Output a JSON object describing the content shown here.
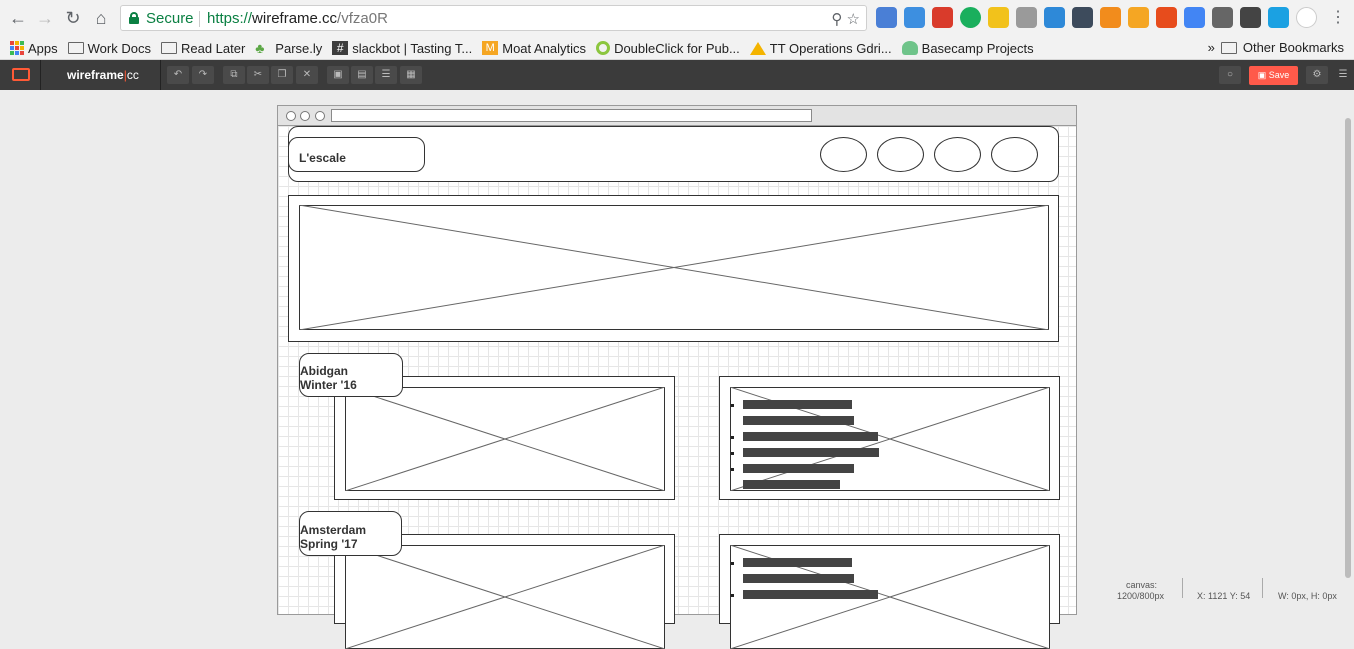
{
  "browser": {
    "secure_label": "Secure",
    "url_scheme": "https://",
    "url_host": "wireframe.cc",
    "url_path": "/vfza0R",
    "extension_icons": [
      "calendar-icon",
      "docs-icon",
      "bookmark-red-icon",
      "evernote-icon",
      "drive-icon",
      "chart-icon",
      "badge-icon",
      "dots-icon",
      "trend-icon",
      "moat-icon",
      "office-icon",
      "translate-icon",
      "inbox-icon",
      "tag-icon",
      "ct-icon",
      "circle-icon"
    ]
  },
  "bookmarks": {
    "items": [
      {
        "label": "Apps",
        "icon": "apps-grid-icon"
      },
      {
        "label": "Work Docs",
        "icon": "folder-icon"
      },
      {
        "label": "Read Later",
        "icon": "folder-icon"
      },
      {
        "label": "Parse.ly",
        "icon": "parsely-icon"
      },
      {
        "label": "slackbot | Tasting T...",
        "icon": "hash-icon"
      },
      {
        "label": "Moat Analytics",
        "icon": "moat-icon"
      },
      {
        "label": "DoubleClick for Pub...",
        "icon": "doubleclick-icon"
      },
      {
        "label": "TT Operations Gdri...",
        "icon": "drive-icon"
      },
      {
        "label": "Basecamp Projects",
        "icon": "basecamp-icon"
      }
    ],
    "overflow_label": "»",
    "other_label": "Other Bookmarks"
  },
  "app": {
    "brand_name": "wireframe",
    "brand_sep": "|",
    "brand_suffix": "cc",
    "save_label": "Save",
    "colors": {
      "accent": "#ff5a36",
      "toolbar_bg": "#3b3b3b",
      "save_bg": "#ff5a4a"
    }
  },
  "wireframe": {
    "header_title": "L'escale",
    "sections": [
      {
        "title_line1": "Abidgan",
        "title_line2": "Winter '16"
      },
      {
        "title_line1": "Amsterdam",
        "title_line2": "Spring '17"
      }
    ]
  },
  "status": {
    "canvas_label": "canvas:",
    "canvas_size": "1200/800px",
    "coords": "X: 1121 Y: 54",
    "dimensions": "W: 0px, H: 0px"
  }
}
